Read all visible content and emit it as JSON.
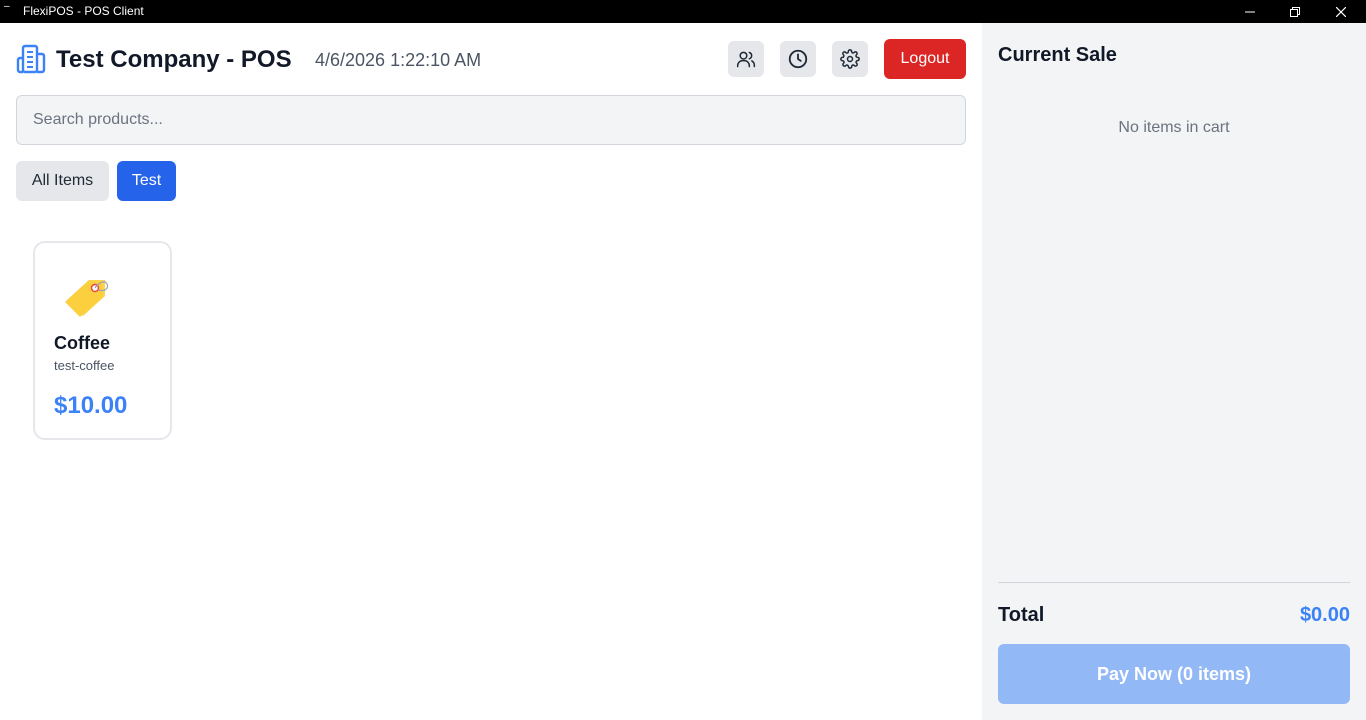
{
  "window": {
    "title": "FlexiPOS - POS Client",
    "icon": "app-icon",
    "controls": [
      "minimize-icon",
      "maximize-icon",
      "close-icon"
    ]
  },
  "header": {
    "logo_icon": "building-icon",
    "company_title": "Test Company - POS",
    "datetime": "4/6/2026 1:22:10 AM",
    "icon_buttons": [
      "users-icon",
      "clock-icon",
      "gear-icon"
    ],
    "logout_label": "Logout"
  },
  "search": {
    "placeholder": "Search products...",
    "value": ""
  },
  "categories": [
    {
      "label": "All Items",
      "active": false
    },
    {
      "label": "Test",
      "active": true
    }
  ],
  "products": [
    {
      "icon": "price-tag-icon",
      "name": "Coffee",
      "sku": "test-coffee",
      "price": "$10.00"
    }
  ],
  "cart": {
    "title": "Current Sale",
    "empty_text": "No items in cart",
    "total_label": "Total",
    "total_value": "$0.00",
    "pay_label": "Pay Now (0 items)"
  },
  "colors": {
    "primary": "#2563eb",
    "accent_text": "#3b82f6",
    "danger": "#dc2626",
    "pay_disabled": "#93b8f6",
    "sidebar_bg": "#f3f4f6"
  }
}
